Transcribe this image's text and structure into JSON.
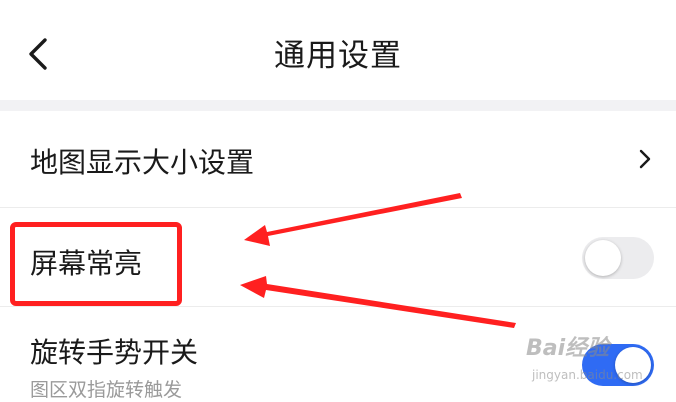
{
  "header": {
    "title": "通用设置",
    "back_icon": "chevron-left-icon"
  },
  "settings": [
    {
      "label": "地图显示大小设置",
      "control": "chevron",
      "icon": "chevron-right-icon"
    },
    {
      "label": "屏幕常亮",
      "control": "toggle",
      "state": "off"
    },
    {
      "label": "旋转手势开关",
      "sublabel": "图区双指旋转触发",
      "control": "toggle",
      "state": "on"
    }
  ],
  "colors": {
    "annotation": "#ff2020",
    "toggle_on": "#2f6bf4",
    "toggle_off": "#ececee",
    "section_gap": "#f2f2f4"
  },
  "watermark": {
    "logo": "Bai经验",
    "url": "jingyan.baidu.com"
  }
}
